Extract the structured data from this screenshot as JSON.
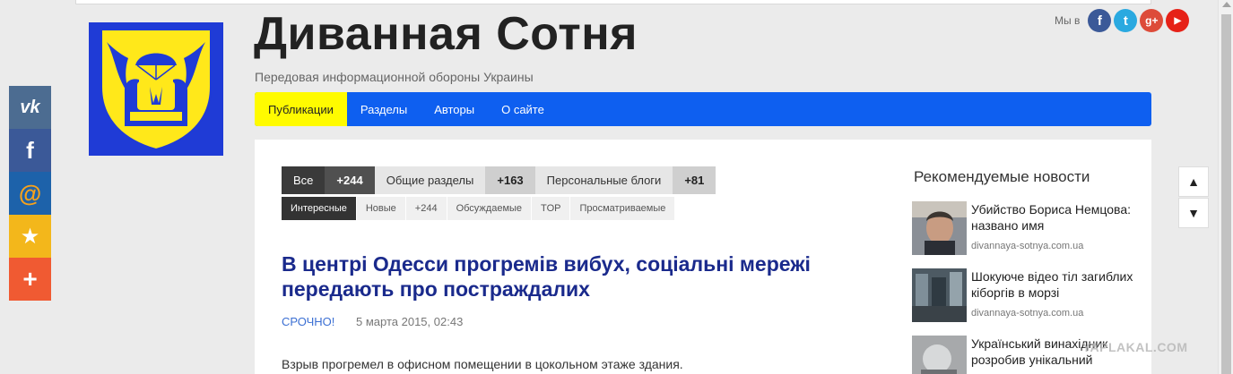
{
  "site": {
    "title": "Диванная Сотня",
    "subtitle": "Передовая информационной обороны Украины"
  },
  "social_top": {
    "label": "Мы в",
    "icons": [
      {
        "name": "facebook-icon",
        "glyph": "f",
        "color": "#3b5998"
      },
      {
        "name": "twitter-icon",
        "glyph": "t",
        "color": "#2aa9e0"
      },
      {
        "name": "google-plus-icon",
        "glyph": "g+",
        "color": "#dd4b39"
      },
      {
        "name": "youtube-icon",
        "glyph": "▶",
        "color": "#e62117"
      }
    ]
  },
  "nav": {
    "items": [
      "Публикации",
      "Разделы",
      "Авторы",
      "О сайте"
    ]
  },
  "sharebar": [
    {
      "name": "vk-share-icon",
      "glyph": "vk",
      "color": "#4c6c91"
    },
    {
      "name": "facebook-share-icon",
      "glyph": "f",
      "color": "#3b5998"
    },
    {
      "name": "mail-share-icon",
      "glyph": "@",
      "color": "#1d62aa"
    },
    {
      "name": "favorite-share-icon",
      "glyph": "★",
      "color": "#f3b71b"
    },
    {
      "name": "more-share-icon",
      "glyph": "+",
      "color": "#f05a32"
    }
  ],
  "tabs": {
    "all": "Все",
    "all_count": "+244",
    "general": "Общие разделы",
    "general_count": "+163",
    "blogs": "Персональные блоги",
    "blogs_count": "+81"
  },
  "subtabs": [
    "Интересные",
    "Новые",
    "+244",
    "Обсуждаемые",
    "TOP",
    "Просматриваемые"
  ],
  "article": {
    "title": "В центрі Одесси прогремів вибух, соціальні мережі передають про постраждалих",
    "category": "СРОЧНО!",
    "date": "5 марта 2015, 02:43",
    "lead": "Взрыв прогремел в офисном помещении в цокольном этаже здания."
  },
  "recommended": {
    "title": "Рекомендуемые новости",
    "items": [
      {
        "title": "Убийство Бориса Немцова: названо имя",
        "source": "divannaya-sotnya.com.ua"
      },
      {
        "title": "Шокуюче відео тіл загиблих кіборгів в морзі",
        "source": "divannaya-sotnya.com.ua"
      },
      {
        "title": "Український винахідник розробив унікальний",
        "source": ""
      }
    ]
  },
  "arrows": {
    "up": "🠕",
    "down": "🠗"
  },
  "watermark": "YAPLAKAL.COM"
}
